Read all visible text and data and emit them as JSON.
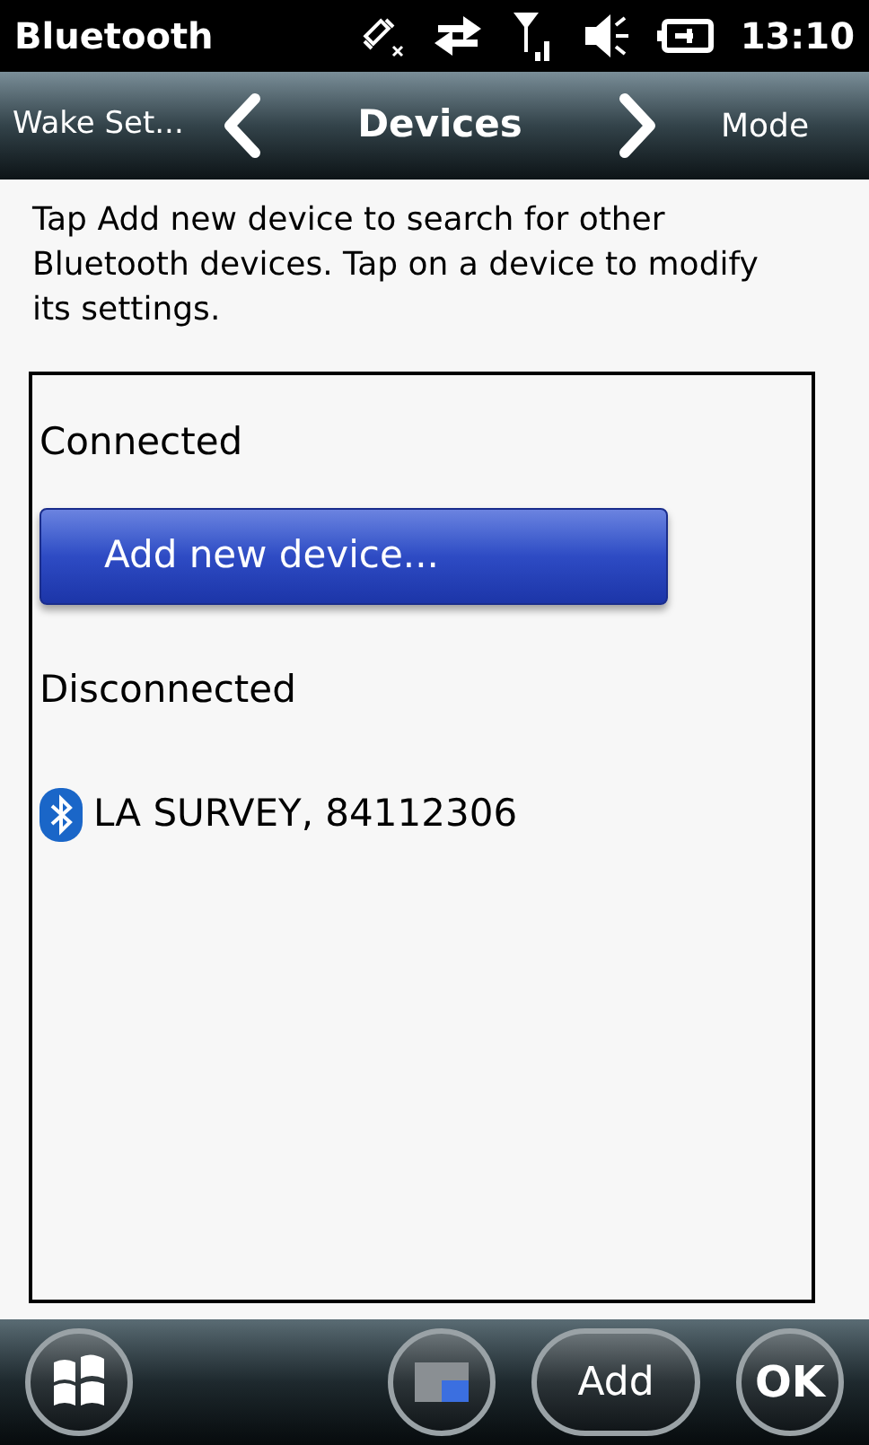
{
  "status_bar": {
    "title": "Bluetooth",
    "time": "13:10"
  },
  "nav": {
    "previous": "Wake Set...",
    "current": "Devices",
    "next": "Mode"
  },
  "instructions": "Tap Add new device to search for other Bluetooth devices. Tap on a device to modify its settings.",
  "list": [
    {
      "kind": "header",
      "text": "Connected"
    },
    {
      "kind": "button",
      "text": "Add new device..."
    },
    {
      "kind": "header",
      "text": "Disconnected"
    },
    {
      "kind": "device",
      "text": "LA SURVEY, 84112306"
    }
  ],
  "softkeys": {
    "add": "Add",
    "ok": "OK"
  }
}
